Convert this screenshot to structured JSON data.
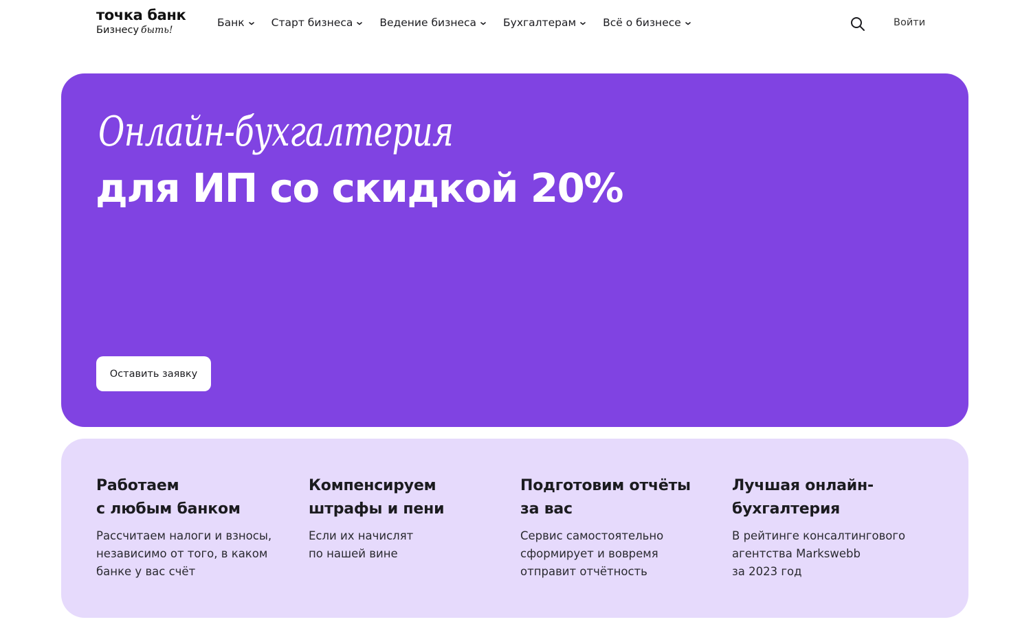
{
  "header": {
    "logo_title": "точка банк",
    "logo_sub": "Бизнесу",
    "logo_script": "быть!",
    "nav": [
      {
        "label": "Банк"
      },
      {
        "label": "Старт бизнеса"
      },
      {
        "label": "Ведение бизнеса"
      },
      {
        "label": "Бухгалтерам"
      },
      {
        "label": "Всё о бизнесе"
      }
    ],
    "search_icon": "search-icon",
    "login_label": "Войти"
  },
  "hero": {
    "title_script": "Онлайн-бухгалтерия",
    "title_bold": "для ИП со скидкой 20%",
    "cta_label": "Оставить заявку",
    "background": "#8043e2"
  },
  "features": {
    "background": "#e6dafc",
    "items": [
      {
        "title": "Работаем\nс любым банком",
        "text": "Рассчитаем налоги и взносы,\nнезависимо от того, в каком\nбанке у вас счёт"
      },
      {
        "title": "Компенсируем\nштрафы и пени",
        "text": "Если их начислят\nпо нашей вине"
      },
      {
        "title": "Подготовим отчёты\nза вас",
        "text": "Сервис самостоятельно\nсформирует и вовремя\nотправит отчётность"
      },
      {
        "title": "Лучшая онлайн-\nбухгалтерия",
        "text": "В рейтинге консалтингового\nагентства Markswebb\nза 2023 год"
      }
    ]
  }
}
